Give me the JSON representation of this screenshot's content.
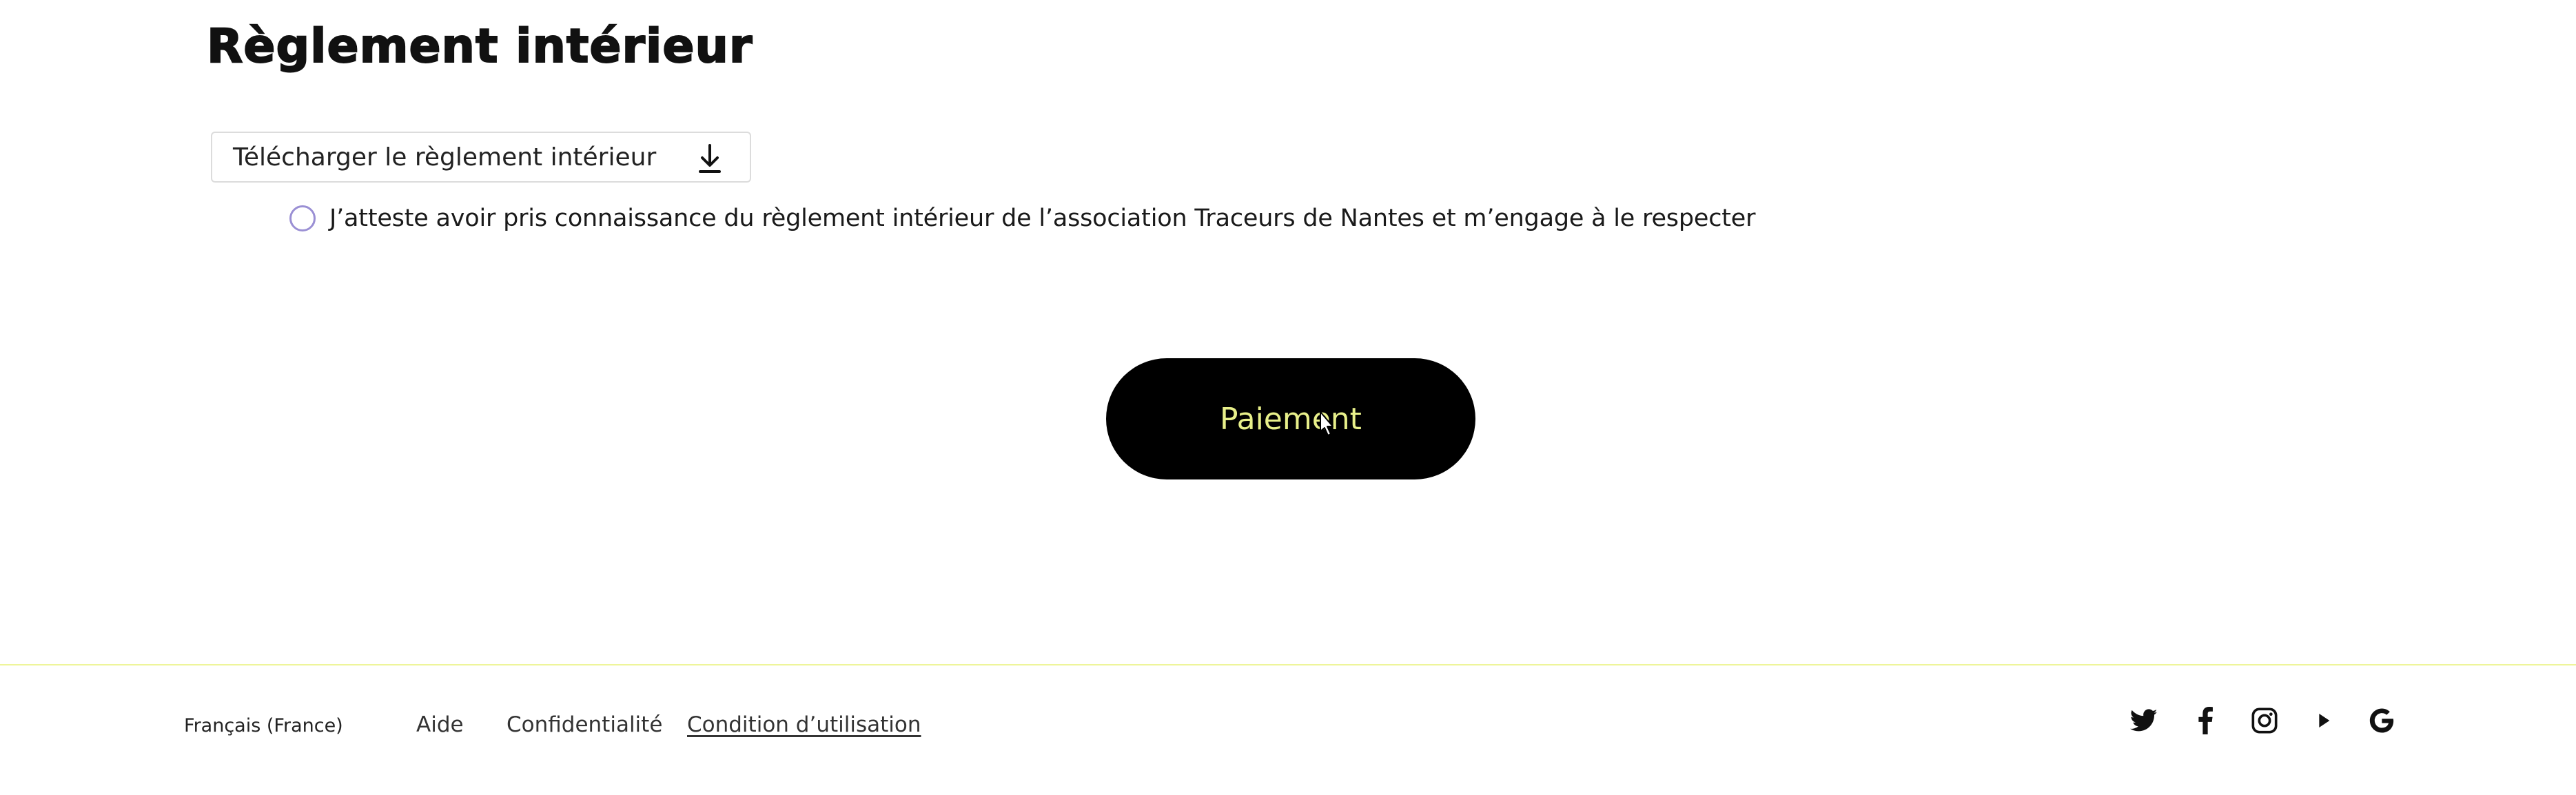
{
  "section": {
    "title": "Règlement intérieur"
  },
  "download": {
    "label": "Télécharger le règlement intérieur",
    "icon": "download-icon"
  },
  "attestation": {
    "text": "J’atteste avoir pris connaissance du règlement intérieur de l’association Traceurs de Nantes et m’engage à le respecter",
    "checked": false
  },
  "payment": {
    "label": "Paiement"
  },
  "footer": {
    "language": "Français (France)",
    "links": {
      "help": "Aide",
      "privacy": "Confidentialité",
      "terms": "Condition d’utilisation"
    },
    "social_icons": [
      "twitter-icon",
      "facebook-icon",
      "instagram-icon",
      "play-icon",
      "google-icon"
    ]
  },
  "colors": {
    "button_bg": "#000000",
    "button_text": "#e8f08a",
    "radio_border": "#9a8fd4",
    "footer_divider": "#eef59a"
  }
}
